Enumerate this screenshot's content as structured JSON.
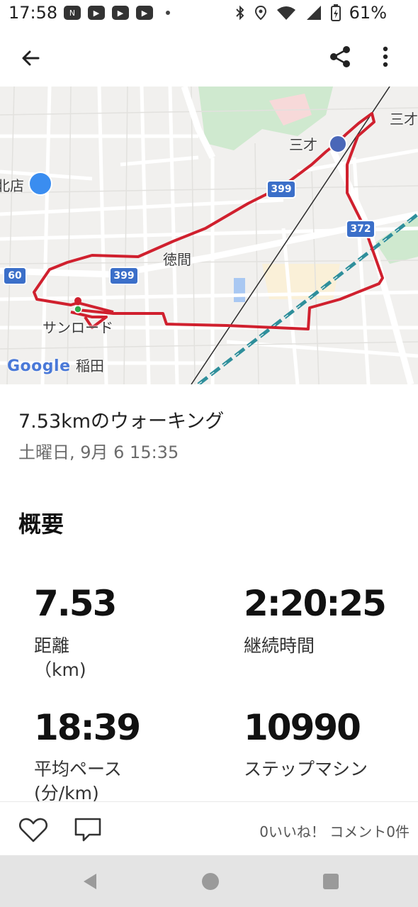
{
  "status_bar": {
    "time": "17:58",
    "battery": "61%",
    "left_icons": [
      "news-icon",
      "youtube-icon",
      "youtube-icon",
      "youtube-icon"
    ],
    "right_icons": [
      "bluetooth-icon",
      "location-icon",
      "wifi-icon",
      "signal-icon",
      "battery-icon"
    ]
  },
  "app_bar": {
    "back_icon": "arrow-left-icon",
    "share_icon": "share-icon",
    "more_icon": "more-vert-icon"
  },
  "map": {
    "labels": {
      "sanzai": "三才",
      "sanzai_edge": "三才",
      "shop": "北店",
      "tokuma": "徳間",
      "sunroad": "サンロード",
      "inada": "稲田"
    },
    "route_numbers": {
      "r399_top": "399",
      "r399_mid": "399",
      "r372": "372",
      "r60": "60"
    },
    "google_logo": "Google",
    "route_color": "#d0202e"
  },
  "activity": {
    "title": "7.53kmのウォーキング",
    "date": "土曜日, 9月 6 15:35"
  },
  "overview": {
    "heading": "概要",
    "distance": {
      "value": "7.53",
      "label": "距離",
      "unit": "（km)"
    },
    "duration": {
      "value": "2:20:25",
      "label": "継続時間"
    },
    "pace": {
      "value": "18:39",
      "label": "平均ペース",
      "unit": "(分/km)"
    },
    "steps": {
      "value": "10990",
      "label": "ステップマシン"
    }
  },
  "footer": {
    "counts": "0いいね！ コメント0件"
  }
}
